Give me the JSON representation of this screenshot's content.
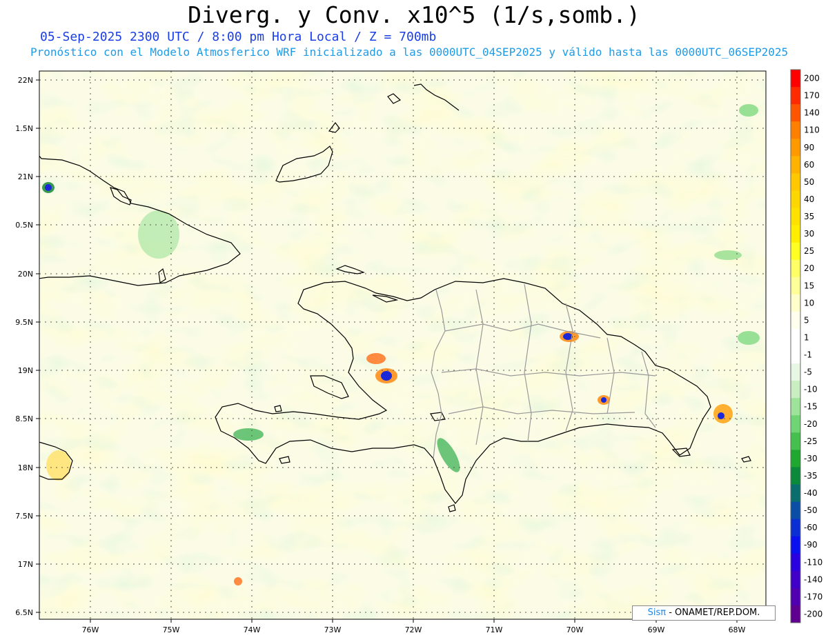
{
  "header": {
    "title": "Diverg. y Conv. x10^5 (1/s,somb.)",
    "subtitle_time": "05-Sep-2025  2300 UTC / 8:00 pm Hora Local / Z = 700mb",
    "subtitle_model": "Pronóstico con el Modelo Atmosferico WRF inicializado a las 0000UTC_04SEP2025 y válido hasta las  0000UTC_06SEP2025"
  },
  "map": {
    "lat_labels": [
      "22N",
      "1.5N",
      "21N",
      "0.5N",
      "20N",
      "9.5N",
      "19N",
      "8.5N",
      "18N",
      "7.5N",
      "17N",
      "6.5N"
    ],
    "lon_labels": [
      "76W",
      "75W",
      "74W",
      "73W",
      "72W",
      "71W",
      "70W",
      "69W",
      "68W"
    ]
  },
  "colorbar": {
    "labels": [
      "200",
      "170",
      "140",
      "110",
      "90",
      "60",
      "50",
      "40",
      "35",
      "30",
      "25",
      "20",
      "15",
      "10",
      "5",
      "1",
      "-1",
      "-5",
      "-10",
      "-15",
      "-20",
      "-25",
      "-30",
      "-35",
      "-40",
      "-50",
      "-60",
      "-90",
      "-110",
      "-140",
      "-170",
      "-200"
    ],
    "colors": [
      "#ff0000",
      "#ff2a00",
      "#ff5500",
      "#ff7f00",
      "#ff9900",
      "#ffb300",
      "#ffc800",
      "#ffd700",
      "#ffe100",
      "#ffee00",
      "#ffff22",
      "#ffff66",
      "#ffff99",
      "#ffffcc",
      "#ffffee",
      "#ffffff",
      "#ffffff",
      "#e8f7e4",
      "#c8eec2",
      "#9ee39a",
      "#6fd473",
      "#45c04f",
      "#1fa830",
      "#0a8a3a",
      "#0a6e6e",
      "#0a4fa5",
      "#0a2fd2",
      "#0a10f0",
      "#2a00e0",
      "#4000c8",
      "#5000b0",
      "#600090"
    ]
  },
  "credit": {
    "brand": "Sis",
    "pi": "π",
    "text": "- ONAMET/REP.DOM."
  }
}
